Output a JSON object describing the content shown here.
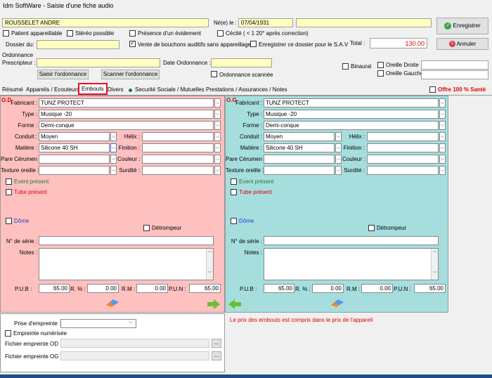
{
  "window": {
    "title": "Idm SoftWare - Saisie d'une fiche audio"
  },
  "patient": {
    "name": "ROUSSELET ANDRE",
    "birth_label": "Né(e) le :",
    "birth_value": "07/04/1931",
    "extra_value": ""
  },
  "header": {
    "patient_appareillable": "Patient appareillable",
    "stereo_possible": "Stéréo possible",
    "presence_evidement": "Présence d'un évidement",
    "cecite": "Cécité ( < 1 20° après correction)",
    "dossier_label": "Dossier du:",
    "vente_bouchons": "Vente de bouchons auditifs sans appareillage",
    "enregistrer_sav": "Enregistrer ce dossier pour le S.A.V",
    "total_label": "Total :",
    "total_value": "130.00",
    "ordonnance_label": "Ordonnance",
    "prescripteur_label": "Prescripteur :",
    "date_ordonnance_label": "Date Ordonnance :",
    "saisir_ordonnance": "Saisir l'ordonnance",
    "scanner_ordonnance": "Scanner l'ordonnance",
    "ordonnance_scannee": "Ordonnance scannée",
    "binaural": "Binaural",
    "oreille_droite": "Oreille Droite",
    "oreille_gauche": "Oreille Gauche",
    "enregistrer": "Enregistrer",
    "annuler": "Annuler"
  },
  "tabs": [
    "Résumé",
    "Appareils / Ecouteurs",
    "Embouts",
    "Divers",
    "Securité Sociale / Mutuelles",
    "Prestations / Assurances / Notes"
  ],
  "offre": "Offre 100 % Santé",
  "labels": {
    "fabricant": "Fabricant :",
    "type": "Type :",
    "forme": "Forme :",
    "conduit": "Conduit :",
    "matiere": "Matière :",
    "pare_cerumen": "Pare Cérumen :",
    "texture": "Texture oreille :",
    "helix": "Hélix :",
    "finition": "Finition :",
    "couleur": "Couleur :",
    "surdite": "Surdité :",
    "event": "Event présent",
    "tube": "Tube présent",
    "dome": "Dôme",
    "detrompeur": "Détrompeur",
    "serie": "N° de série :",
    "notes": "Notes :",
    "pub": "P.U.B :",
    "r": "R. % :",
    "rm": "R.M :",
    "pun": "P.U.N :"
  },
  "od": {
    "title": "O.D",
    "fabricant": "TUNZ PROTECT",
    "type": "Musique -20",
    "forme": "Demi-conque",
    "conduit": "Moyen",
    "matiere": "Silicone 40 SH",
    "pub": "65.00",
    "r": "0.00",
    "rm": "0.00",
    "pun": "65.00"
  },
  "og": {
    "title": "O.G",
    "fabricant": "TUNZ PROTECT",
    "type": "Musique -20",
    "forme": "Demi-conque",
    "conduit": "Moyen",
    "matiere": "Silicone 40 SH",
    "pub": "65.00",
    "r": "0.00",
    "rm": "0.00",
    "pun": "65.00"
  },
  "bottom": {
    "prise_label": "Prise d'empreinte :",
    "empreinte_numerisee": "Empreinte numérisée",
    "fichier_od": "Fichier empreinte OD :",
    "fichier_og": "Fichier empreinte OG :",
    "browse": "...",
    "info": "Le prix des embouts est compris dans le prix de l'appareil"
  },
  "colors": {
    "od_bg": "#ffc0c0",
    "og_bg": "#a6dede",
    "red": "#e00000",
    "accent": "#e81123"
  }
}
